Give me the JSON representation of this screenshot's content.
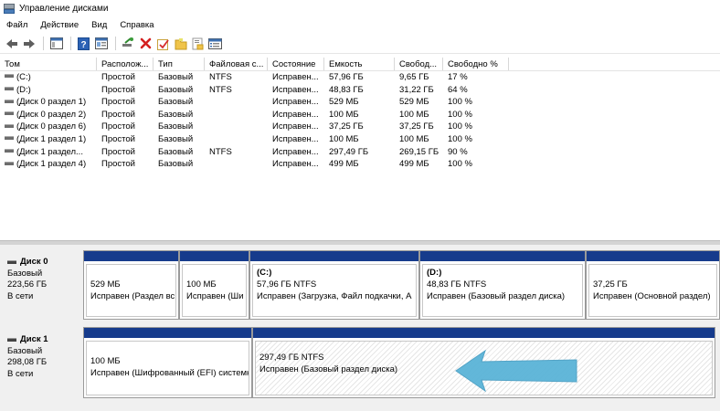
{
  "window": {
    "title": "Управление дисками"
  },
  "menu": [
    "Файл",
    "Действие",
    "Вид",
    "Справка"
  ],
  "toolbar": {
    "icons": [
      "back-arrow-icon",
      "forward-arrow-icon",
      "console-tree-icon",
      "help-icon",
      "properties-icon",
      "connect-icon",
      "delete-x-icon",
      "check-icon",
      "folder-icon",
      "folder-search-icon",
      "list-view-icon"
    ]
  },
  "volumes": {
    "columns": [
      "Том",
      "Располож...",
      "Тип",
      "Файловая с...",
      "Состояние",
      "Емкость",
      "Свобод...",
      "Свободно %"
    ],
    "rows": [
      [
        "(C:)",
        "Простой",
        "Базовый",
        "NTFS",
        "Исправен...",
        "57,96 ГБ",
        "9,65 ГБ",
        "17 %"
      ],
      [
        "(D:)",
        "Простой",
        "Базовый",
        "NTFS",
        "Исправен...",
        "48,83 ГБ",
        "31,22 ГБ",
        "64 %"
      ],
      [
        "(Диск 0 раздел 1)",
        "Простой",
        "Базовый",
        "",
        "Исправен...",
        "529 МБ",
        "529 МБ",
        "100 %"
      ],
      [
        "(Диск 0 раздел 2)",
        "Простой",
        "Базовый",
        "",
        "Исправен...",
        "100 МБ",
        "100 МБ",
        "100 %"
      ],
      [
        "(Диск 0 раздел 6)",
        "Простой",
        "Базовый",
        "",
        "Исправен...",
        "37,25 ГБ",
        "37,25 ГБ",
        "100 %"
      ],
      [
        "(Диск 1 раздел 1)",
        "Простой",
        "Базовый",
        "",
        "Исправен...",
        "100 МБ",
        "100 МБ",
        "100 %"
      ],
      [
        "(Диск 1 раздел...",
        "Простой",
        "Базовый",
        "NTFS",
        "Исправен...",
        "297,49 ГБ",
        "269,15 ГБ",
        "90 %"
      ],
      [
        "(Диск 1 раздел 4)",
        "Простой",
        "Базовый",
        "",
        "Исправен...",
        "499 МБ",
        "499 МБ",
        "100 %"
      ]
    ]
  },
  "disks": [
    {
      "name": "Диск 0",
      "type": "Базовый",
      "size": "223,56 ГБ",
      "status": "В сети",
      "partitions": [
        {
          "title": "",
          "size": "529 МБ",
          "status": "Исправен (Раздел вс"
        },
        {
          "title": "",
          "size": "100 МБ",
          "status": "Исправен (Ши"
        },
        {
          "title": "(C:)",
          "size": "57,96 ГБ NTFS",
          "status": "Исправен (Загрузка, Файл подкачки, А"
        },
        {
          "title": "(D:)",
          "size": "48,83 ГБ NTFS",
          "status": "Исправен (Базовый раздел диска)"
        },
        {
          "title": "",
          "size": "37,25 ГБ",
          "status": "Исправен (Основной раздел)"
        }
      ]
    },
    {
      "name": "Диск 1",
      "type": "Базовый",
      "size": "298,08 ГБ",
      "status": "В сети",
      "partitions": [
        {
          "title": "",
          "size": "100 МБ",
          "status": "Исправен (Шифрованный (EFI) системн"
        },
        {
          "title": "",
          "size": "297,49 ГБ NTFS",
          "status": "Исправен (Базовый раздел диска)"
        }
      ]
    }
  ],
  "colors": {
    "partition_bar": "#163b8c",
    "arrow": "#5ab4d8"
  }
}
